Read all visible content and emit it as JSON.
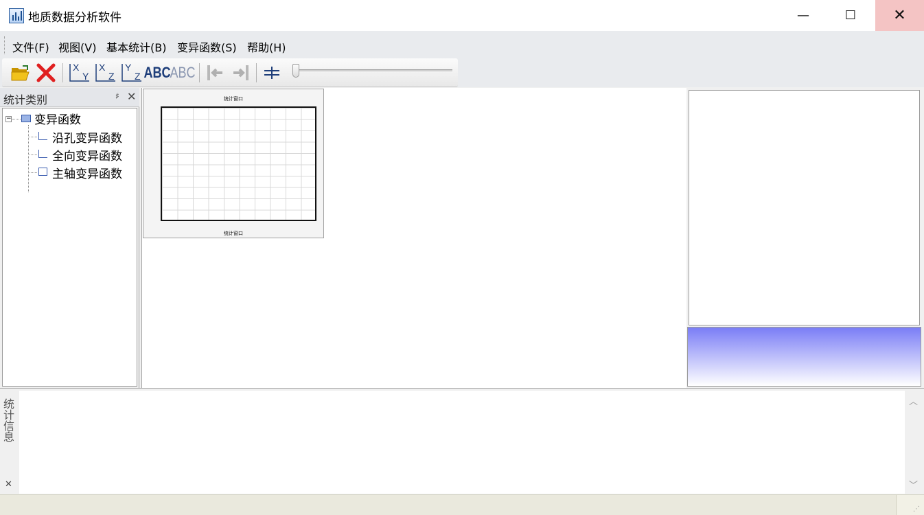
{
  "window": {
    "title": "地质数据分析软件",
    "min_glyph": "—",
    "max_glyph": "☐",
    "close_glyph": "✕"
  },
  "menu": [
    {
      "label": "文件(F)"
    },
    {
      "label": "视图(V)"
    },
    {
      "label": "基本统计(B)"
    },
    {
      "label": "变异函数(S)"
    },
    {
      "label": "帮助(H)"
    }
  ],
  "toolbar": {
    "open_icon": "folder-open-icon",
    "delete_icon": "delete-x-icon",
    "axis_xy": {
      "a": "X",
      "b": "Y"
    },
    "axis_xz": {
      "a": "X",
      "b": "Z"
    },
    "axis_yz": {
      "a": "Y",
      "b": "Z"
    },
    "abc_bold": "ABC",
    "abc_light": "ABC",
    "colors": {
      "delete": "#e02020",
      "axis": "#1e3e7a",
      "folder": "#e6b400"
    }
  },
  "left_panel": {
    "title": "统计类别",
    "pin_glyph": "♯",
    "close_glyph": "✕",
    "tree": {
      "expander": "−",
      "root": "变异函数",
      "children": [
        {
          "label": "沿孔变异函数",
          "icon": "line-chart-icon"
        },
        {
          "label": "全向变异函数",
          "icon": "scatter-chart-icon"
        },
        {
          "label": "主轴变异函数",
          "icon": "area-chart-icon"
        }
      ]
    }
  },
  "stat_window": {
    "top_label": "统计窗口",
    "bottom_label": "统计窗口"
  },
  "bottom_panel": {
    "tab_label": "统计信息",
    "close_glyph": "✕",
    "scroll_up": "︿",
    "scroll_down": "﹀"
  },
  "status_bar": {
    "grip_glyph": "⋰"
  },
  "colors": {
    "close_hover": "#f4c4c4",
    "gradient_top": "#7a7df6",
    "gradient_bottom": "#ffffff"
  }
}
